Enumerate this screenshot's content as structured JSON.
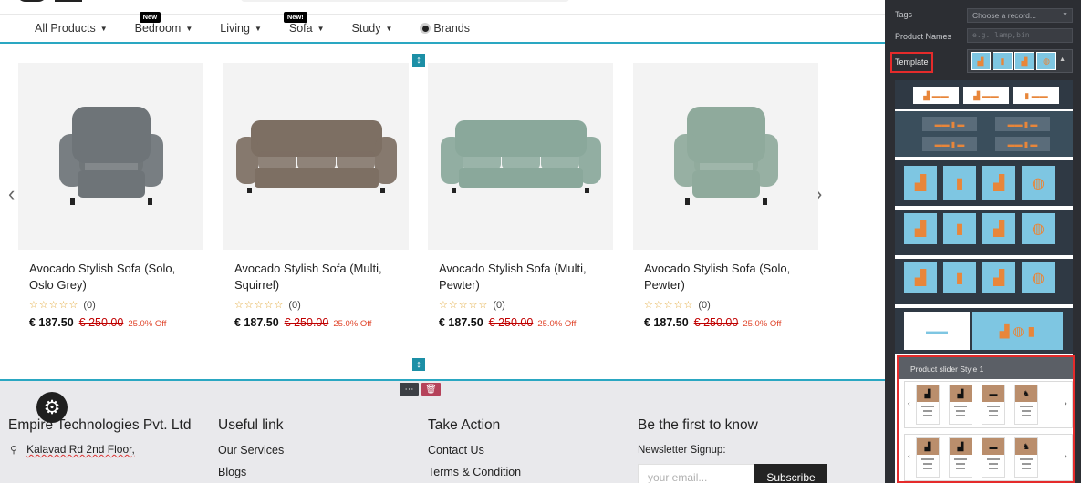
{
  "nav": {
    "items": [
      {
        "label": "All Products",
        "badge": ""
      },
      {
        "label": "Bedroom",
        "badge": "New"
      },
      {
        "label": "Living",
        "badge": ""
      },
      {
        "label": "Sofa",
        "badge": "New!"
      },
      {
        "label": "Study",
        "badge": ""
      }
    ],
    "brands_label": "Brands"
  },
  "products": [
    {
      "name": "Avocado Stylish Sofa (Solo, Oslo Grey)",
      "rating_count": "(0)",
      "price": "€ 187.50",
      "old_price": "€ 250.00",
      "discount": "25.0% Off",
      "color": "#6e7478",
      "type": "armchair"
    },
    {
      "name": "Avocado Stylish Sofa (Multi, Squirrel)",
      "rating_count": "(0)",
      "price": "€ 187.50",
      "old_price": "€ 250.00",
      "discount": "25.0% Off",
      "color": "#7d6f63",
      "type": "sofa"
    },
    {
      "name": "Avocado Stylish Sofa (Multi, Pewter)",
      "rating_count": "(0)",
      "price": "€ 187.50",
      "old_price": "€ 250.00",
      "discount": "25.0% Off",
      "color": "#8aa89b",
      "type": "sofa"
    },
    {
      "name": "Avocado Stylish Sofa (Solo, Pewter)",
      "rating_count": "(0)",
      "price": "€ 187.50",
      "old_price": "€ 250.00",
      "discount": "25.0% Off",
      "color": "#8faa9c",
      "type": "armchair"
    }
  ],
  "stars": "☆☆☆☆☆",
  "footer": {
    "company": "Empire Technologies Pvt. Ltd",
    "address": "Kalavad Rd 2nd Floor,",
    "useful_title": "Useful link",
    "useful_links": [
      "Our Services",
      "Blogs"
    ],
    "action_title": "Take Action",
    "action_links": [
      "Contact Us",
      "Terms & Condition"
    ],
    "news_title": "Be the first to know",
    "newsletter_label": "Newsletter Signup:",
    "email_placeholder": "your email...",
    "subscribe_label": "Subscribe"
  },
  "panel": {
    "tags_label": "Tags",
    "tags_value": "Choose a record...",
    "product_names_label": "Product Names",
    "product_names_placeholder": "e.g. lamp,bin",
    "template_label": "Template",
    "slider_title": "Product slider Style 1"
  },
  "colors": {
    "accent_border": "#2aa7c2",
    "highlight_red": "#e52b2b",
    "discount": "#e0452b",
    "panel_bg": "#2c2e33"
  }
}
